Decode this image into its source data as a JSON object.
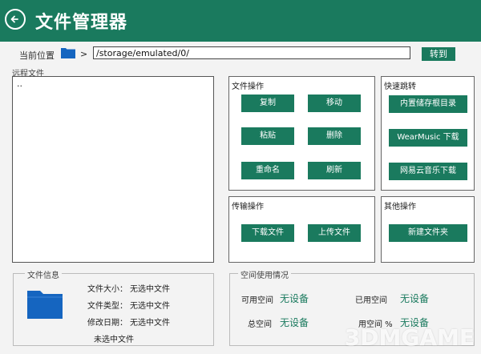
{
  "window": {
    "title": "文件管理器"
  },
  "path": {
    "label": "当前位置",
    "separator": ">",
    "value": "/storage/emulated/0/",
    "go_label": "转到"
  },
  "remote": {
    "label": "远程文件",
    "items": [
      ".."
    ]
  },
  "file_ops": {
    "title": "文件操作",
    "copy": "复制",
    "move": "移动",
    "paste": "粘贴",
    "delete": "删除",
    "rename": "重命名",
    "refresh": "刷新"
  },
  "quick_jump": {
    "title": "快速跳转",
    "internal_root": "内置储存根目录",
    "wearmusic": "WearMusic 下载",
    "netease": "网易云音乐下载"
  },
  "transfer_ops": {
    "title": "传输操作",
    "download": "下载文件",
    "upload": "上传文件"
  },
  "other_ops": {
    "title": "其他操作",
    "new_folder": "新建文件夹"
  },
  "file_info": {
    "legend": "文件信息",
    "size_label": "文件大小：",
    "size_value": "无选中文件",
    "type_label": "文件类型：",
    "type_value": "无选中文件",
    "date_label": "修改日期：",
    "date_value": "无选中文件",
    "name": "未选中文件"
  },
  "space": {
    "legend": "空间使用情况",
    "available_label": "可用空间",
    "available_value": "无设备",
    "used_label": "已用空间",
    "used_value": "无设备",
    "total_label": "总空间",
    "total_value": "无设备",
    "used_pct_label": "用空间 %",
    "used_pct_value": "无设备"
  },
  "watermark": {
    "text": "3DMGAME"
  },
  "colors": {
    "accent": "#1a7a5e"
  }
}
